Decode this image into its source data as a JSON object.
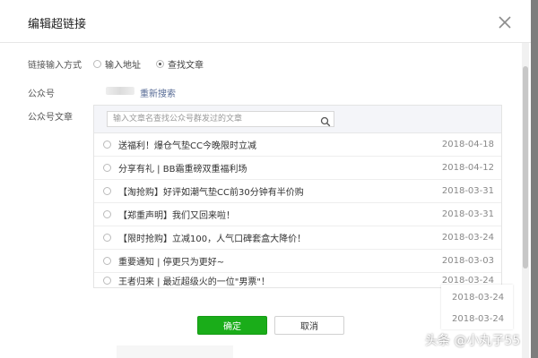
{
  "dialog": {
    "title": "编辑超链接",
    "link_mode": {
      "label": "链接输入方式",
      "options": [
        {
          "label": "输入地址",
          "selected": false
        },
        {
          "label": "查找文章",
          "selected": true
        }
      ]
    },
    "account": {
      "label": "公众号",
      "research_label": "重新搜索"
    },
    "articles": {
      "label": "公众号文章",
      "search_placeholder": "输入文章名查找公众号群发过的文章",
      "items": [
        {
          "title": "送福利！爆仓气垫CC今晚限时立减",
          "date": "2018-04-18"
        },
        {
          "title": "分享有礼 | BB霜重磅双重福利场",
          "date": "2018-04-12"
        },
        {
          "title": "【淘抢购】好评如潮气垫CC前30分钟有半价购",
          "date": "2018-03-31"
        },
        {
          "title": "【郑重声明】我们又回来啦！",
          "date": "2018-03-31"
        },
        {
          "title": "【限时抢购】立减100，人气口碑套盒大降价！",
          "date": "2018-03-24"
        },
        {
          "title": "重要通知 | 停更只为更好~",
          "date": "2018-03-03"
        },
        {
          "title": "王者归来 | 最近超级火的一位\"男票\"！",
          "date": "2018-03-24"
        }
      ],
      "overflow_dates": [
        "2018-03-24",
        "2018-03-24"
      ]
    },
    "buttons": {
      "confirm": "确定",
      "cancel": "取消"
    }
  },
  "watermark": "头条 @小丸子55",
  "colors": {
    "primary_green": "#1aad19",
    "link_blue": "#576b95"
  }
}
